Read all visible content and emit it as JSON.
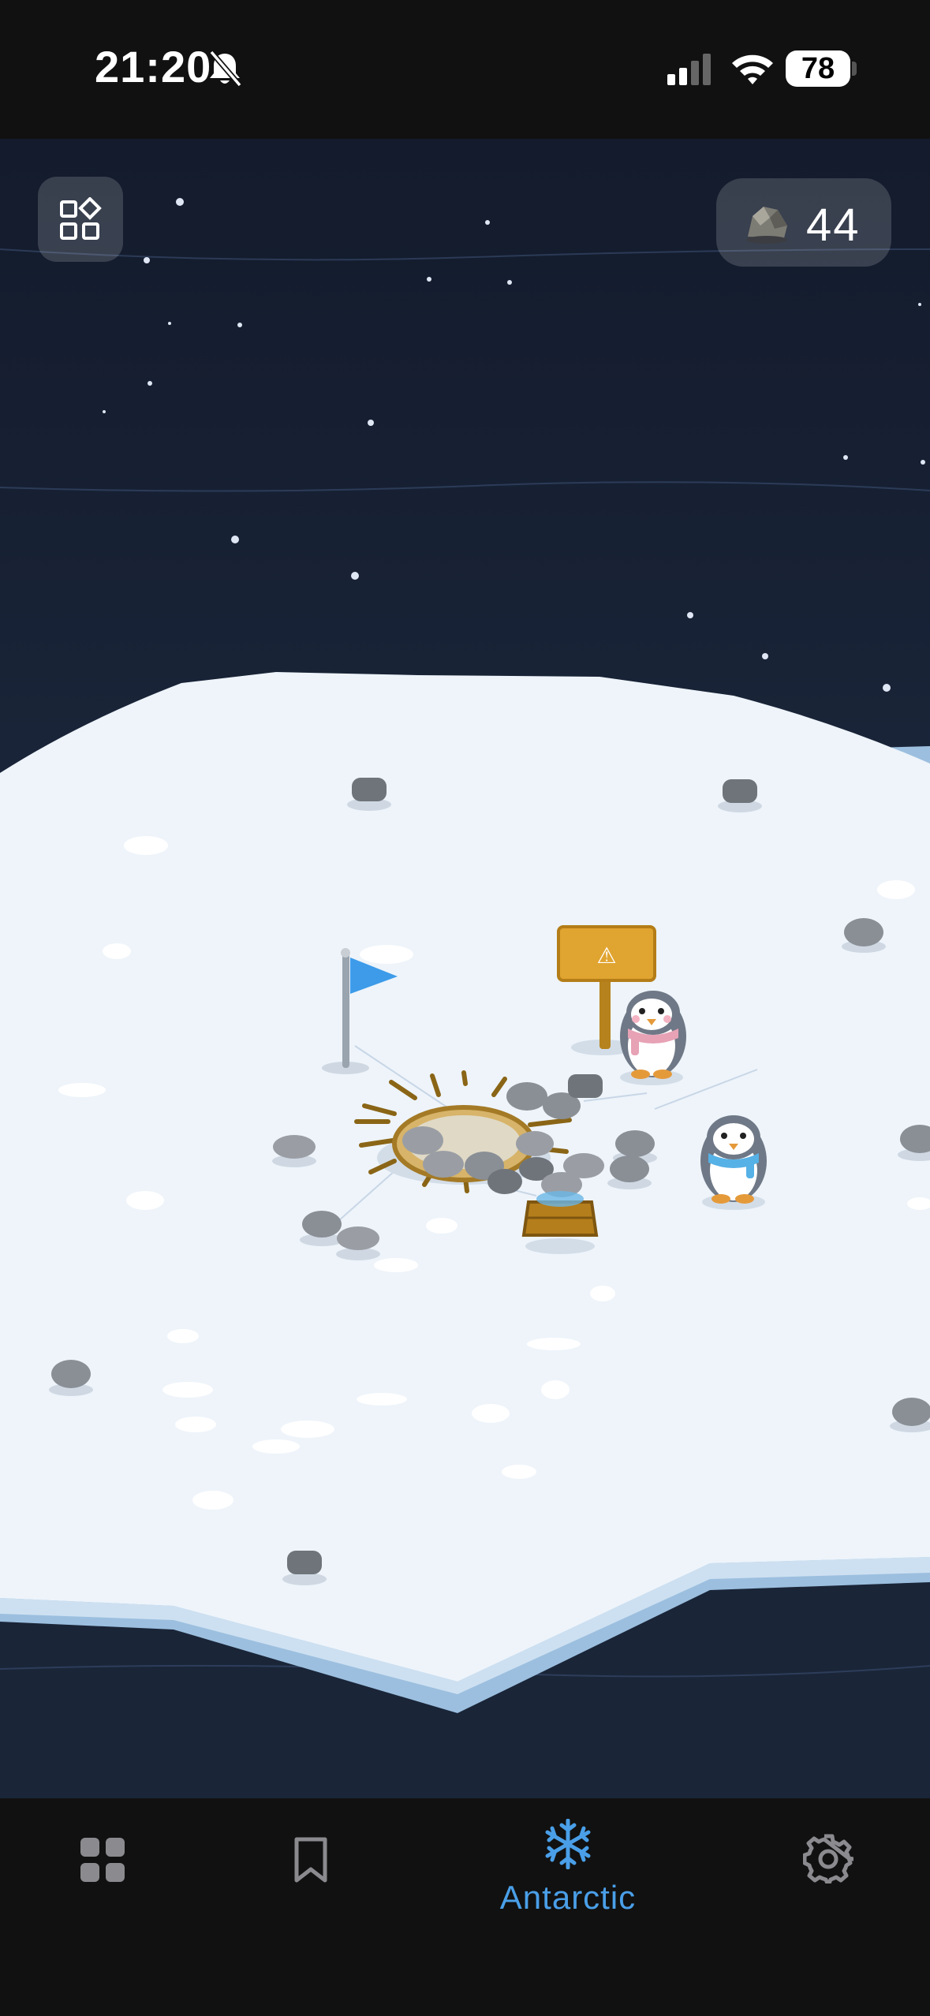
{
  "status_bar": {
    "time": "21:20",
    "battery": "78",
    "icons": [
      "bell-slash-icon",
      "cellular-signal-icon",
      "wifi-icon",
      "battery-icon"
    ]
  },
  "header": {
    "menu_icon": "grid-shapes-icon",
    "stones_icon": "rock-icon",
    "stones_count": "44"
  },
  "scene": {
    "sign_symbol": "⚠",
    "flag_color": "#3d9be9",
    "penguins": [
      {
        "scarf_color": "#e7a2b6"
      },
      {
        "scarf_color": "#56b1e6"
      }
    ]
  },
  "tab_bar": {
    "tabs": [
      {
        "icon": "grid-icon",
        "label": "",
        "active": false
      },
      {
        "icon": "bookmark-icon",
        "label": "",
        "active": false
      },
      {
        "icon": "snowflake-icon",
        "label": "Antarctic",
        "active": true
      },
      {
        "icon": "gear-icon",
        "label": "",
        "active": false
      }
    ],
    "active_color": "#4a9fe8",
    "inactive_color": "#8a8a8f"
  }
}
